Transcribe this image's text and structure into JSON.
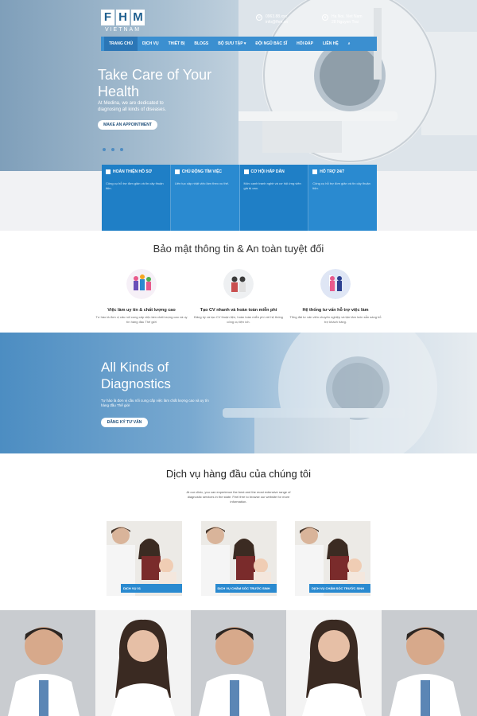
{
  "logo": {
    "letters": [
      "F",
      "H",
      "M"
    ],
    "subtitle": "VIETNAM"
  },
  "contact": {
    "phone": {
      "line1": "0963.88.xxx",
      "line2": "info@fhm.vn"
    },
    "address": {
      "line1": "Ha Noi, Viet Nam",
      "line2": "28 Nguyen Trai"
    }
  },
  "nav": {
    "items": [
      "TRANG CHỦ",
      "DỊCH VỤ",
      "THIẾT BỊ",
      "BLOGS",
      "BỘ SƯU TẬP ▾",
      "ĐỘI NGŨ BÁC SĨ",
      "HỎI ĐÁP",
      "LIÊN HỆ"
    ],
    "search_icon": "search-icon"
  },
  "hero": {
    "title": "Take Care of Your Health",
    "subtitle": "At Medina, we are dedicated to diagnosing all kinds of diseases.",
    "button": "MAKE AN APPOINTMENT"
  },
  "features": [
    {
      "title": "HOÀN THIỆN HỒ SƠ",
      "text": "Công cụ hỗ trợ đơn giản và tin cậy thuận tiện."
    },
    {
      "title": "CHỦ ĐỘNG TÌM VIỆC",
      "text": "Liên tục cập nhật việc làm theo xu thế."
    },
    {
      "title": "CƠ HỘI HẤP DẪN",
      "text": "Mức cạnh tranh nghề và cơ hội ứng viên giá trị cao."
    },
    {
      "title": "HỖ TRỢ 24/7",
      "text": "Công cụ hỗ trợ đơn giản và tin cậy thuận tiện."
    }
  ],
  "security": {
    "title": "Bảo mật thông tin & An toàn tuyệt đối",
    "items": [
      {
        "name": "Việc làm uy tín & chất lượng cao",
        "text": "Tư hào là đơn vị cấu nối cung cấp việc làm chất lượng cao và uy tín hàng đầu Thế giới"
      },
      {
        "name": "Tạo CV nhanh và hoàn toàn miễn phí",
        "text": "Đăng ký và tạo CV thuận tiện, hoàn toàn miễn phí với hệ thống công cụ tiện ích."
      },
      {
        "name": "Hệ thống tư vấn hỗ trợ việc làm",
        "text": "Tổng đài tư vấn viên chuyên nghiệp và tận tâm luôn sẵn sàng hỗ trợ khách hàng."
      }
    ]
  },
  "diagnostics": {
    "title": "All Kinds of Diagnostics",
    "subtitle": "Tự hào là đơn vị cầu nối cung cấp việc làm chất lượng cao và uy tín hàng đầu Thế giới",
    "button": "ĐĂNG KÝ TƯ VẤN"
  },
  "services": {
    "title": "Dịch vụ hàng đầu của chúng tôi",
    "description": "At our clinic, you can experience the best and the most extensive range of diagnostic services in the state. Feel free to browse our website for more information.",
    "cards": [
      "DỊCH VỤ 01",
      "DỊCH VỤ CHĂM SÓC TRƯỚC SINH",
      "DỊCH VỤ CHĂM SÓC TRƯỚC SINH"
    ]
  },
  "colors": {
    "primary": "#2a8ad0",
    "nav": "#3b8fd0",
    "dark_blue": "#1f5f8f"
  }
}
